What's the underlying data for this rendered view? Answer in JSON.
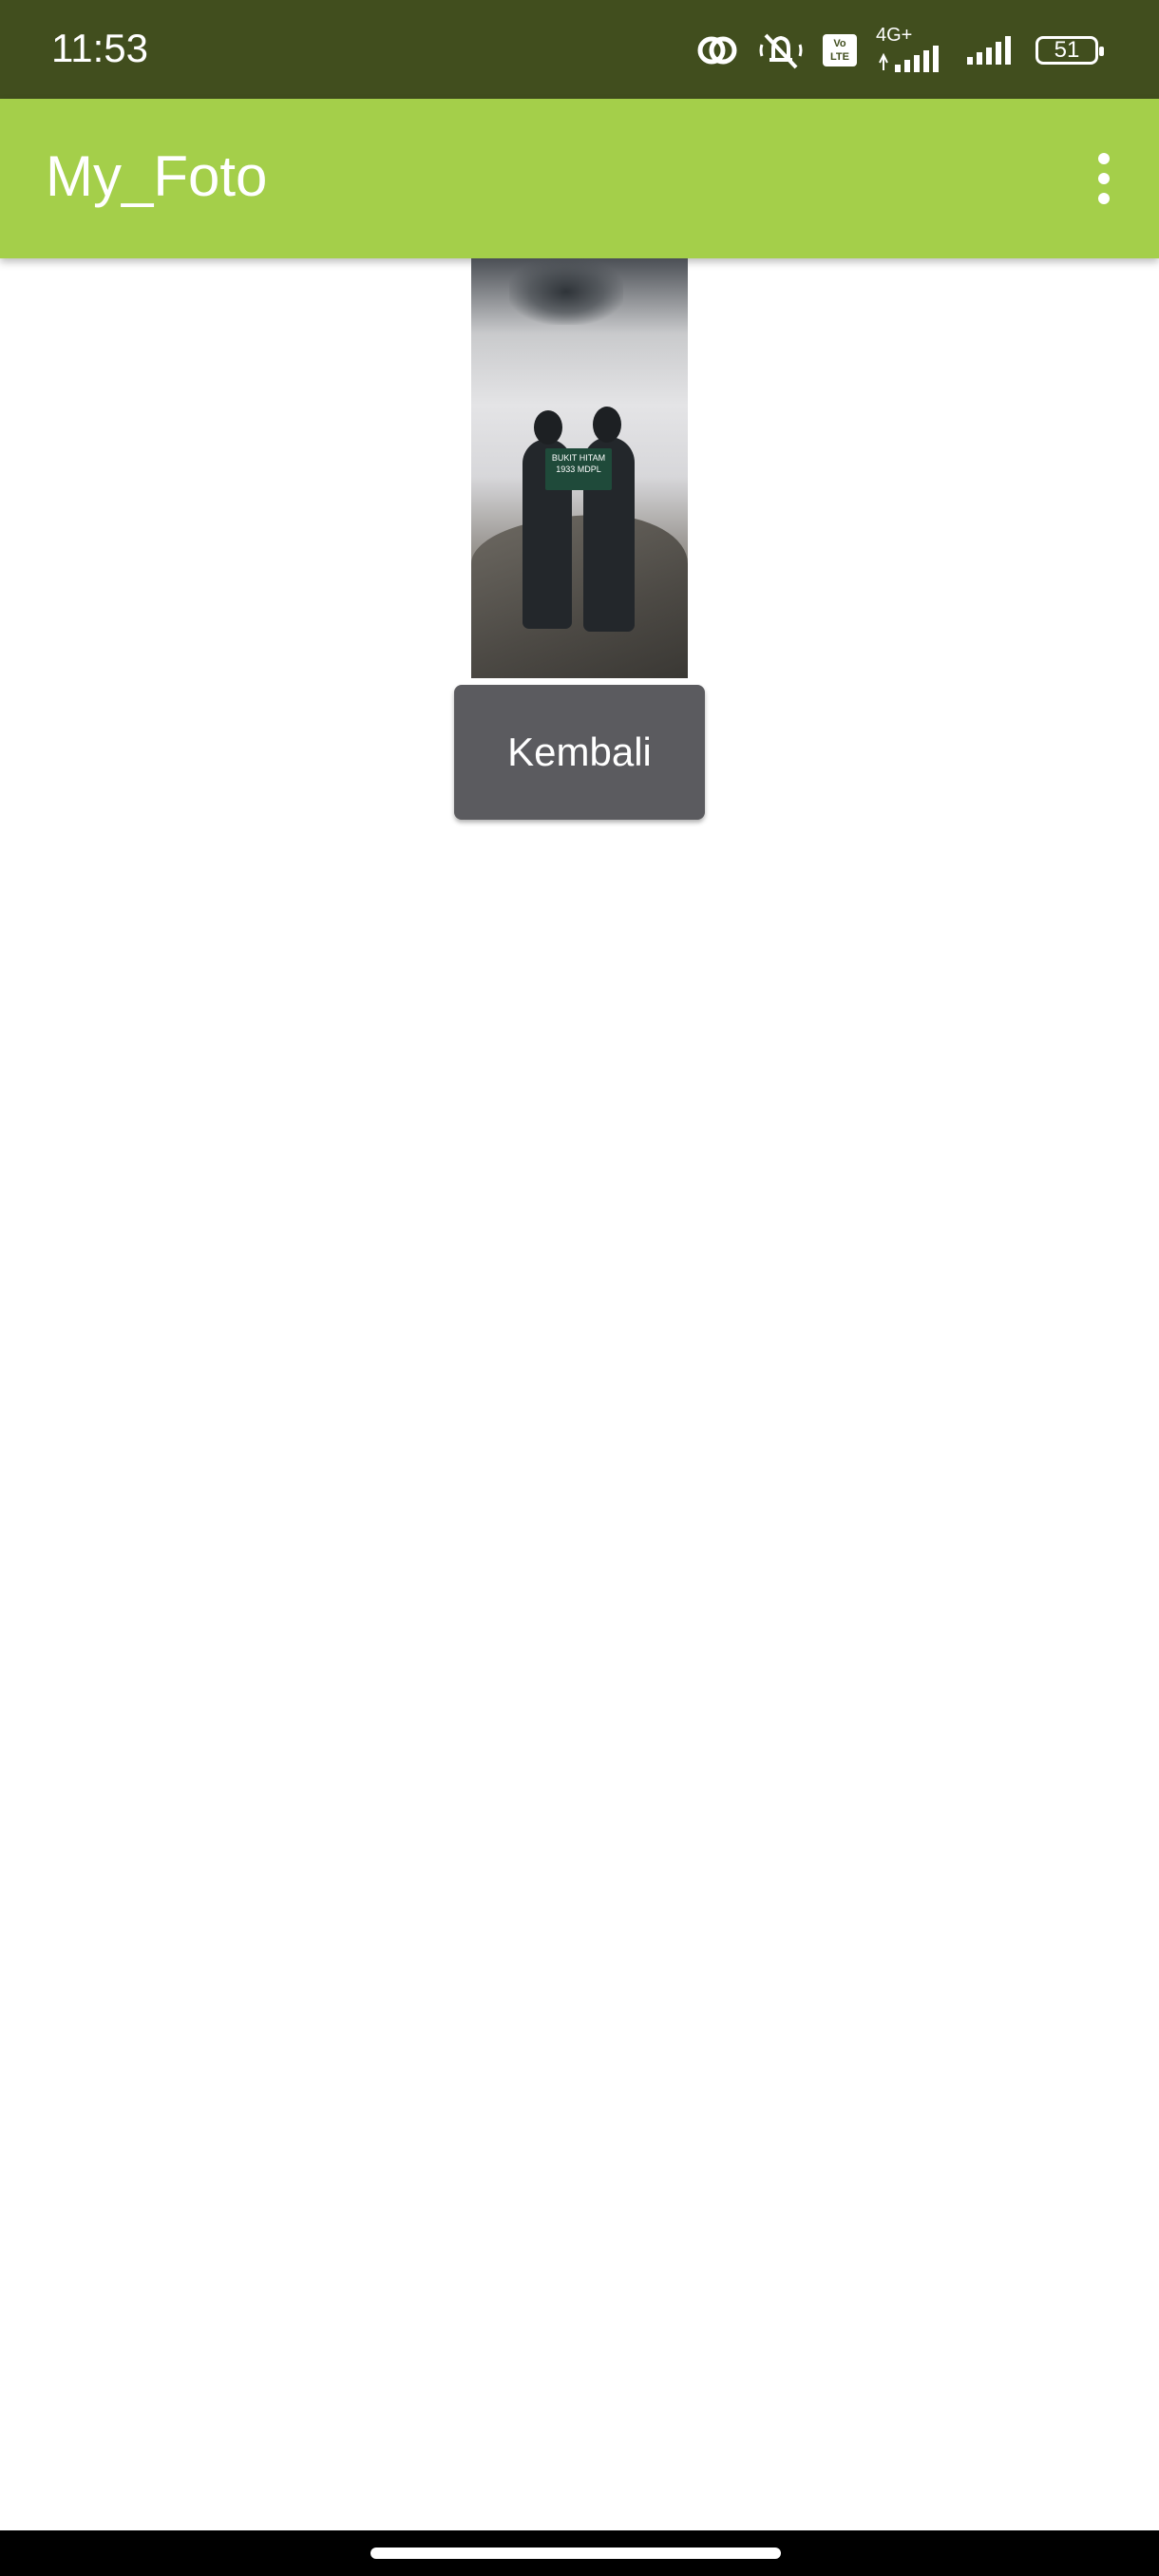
{
  "status_bar": {
    "time": "11:53",
    "battery_level": "51",
    "network_label": "4G+",
    "volte_label": "Vo LTE",
    "icons": [
      "hotspot-icon",
      "muted-bell-icon",
      "volte-icon",
      "signal-4g-icon",
      "signal-icon",
      "battery-icon"
    ]
  },
  "app_bar": {
    "title": "My_Foto",
    "menu_icon": "overflow-menu-icon",
    "color": "#a4cf4a"
  },
  "photo": {
    "sign_line1": "BUKIT HITAM",
    "sign_line2": "1933 MDPL"
  },
  "main": {
    "back_button_label": "Kembali"
  },
  "colors": {
    "status_bar": "#414e1e",
    "button": "#5b5b5f"
  }
}
